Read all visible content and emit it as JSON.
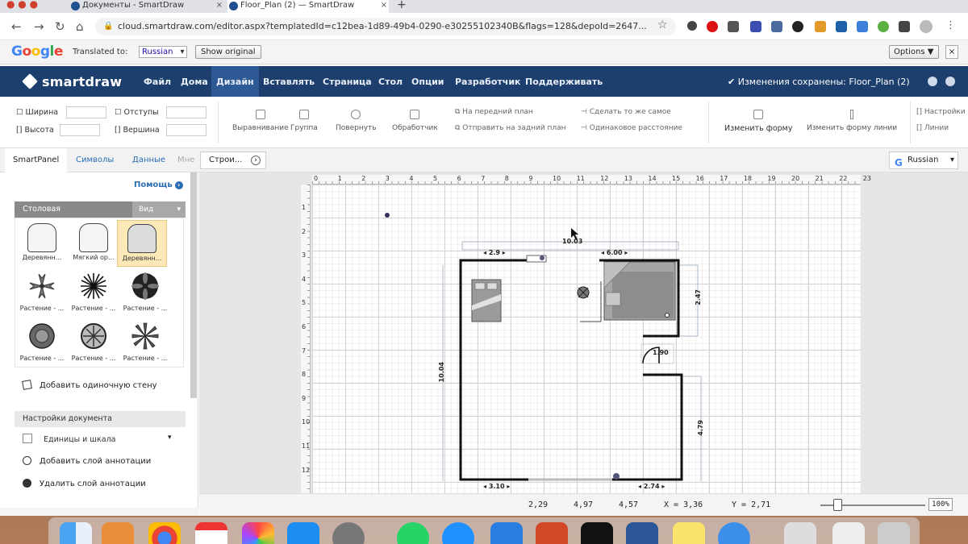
{
  "browser": {
    "tabs": [
      {
        "label": "Документы - SmartDraw",
        "active": false
      },
      {
        "label": "Floor_Plan (2) — SmartDraw",
        "active": true
      }
    ],
    "url": "cloud.smartdraw.com/editor.aspx?templatedId=c12bea-1d89-49b4-0290-e30255102340B&flags=128&depoId=2647...",
    "nav": {
      "back": "←",
      "forward": "→",
      "reload": "↻",
      "home": "⌂",
      "new_tab": "+",
      "close": "×",
      "bookmark": "☆"
    }
  },
  "translate_bar": {
    "logo": "Google",
    "label": "Translated to:",
    "language": "Russian",
    "show_original": "Show original",
    "options": "Options ▼",
    "close": "×"
  },
  "app": {
    "logo": "smartdraw",
    "menu": [
      "Файл",
      "Дома",
      "Дизайн",
      "Вставлять",
      "Страница",
      "Стол",
      "Опции",
      "Разработчик",
      "Поддерживать"
    ],
    "active_menu": "Дизайн",
    "saved_status": "Изменения сохранены: Floor_Plan (2)"
  },
  "ribbon": {
    "fields": [
      {
        "label": "Ширина",
        "value": ""
      },
      {
        "label": "Высота",
        "value": ""
      },
      {
        "label": "Отступы",
        "value": ""
      },
      {
        "label": "Вершина",
        "value": ""
      }
    ],
    "tools": [
      "Выравнивание",
      "Группа",
      "Повернуть",
      "Обработчик"
    ],
    "lines": [
      "На передний план",
      "Отправить на задний план",
      "Сделать то же самое",
      "Одинаковое расстояние"
    ],
    "change_shape": "Изменить форму",
    "extra": "Изменить форму линии",
    "right": [
      "Настройки",
      "Линии"
    ]
  },
  "panel_tabs": [
    "SmartPanel",
    "Символы",
    "Данные",
    "Мне"
  ],
  "doc_button": "Строи...",
  "lang_select": "Russian",
  "left_panel": {
    "help": "Помощь",
    "library": "Столовая",
    "view": "Вид",
    "symbols": [
      "Деревянн...",
      "Мягкий ор...",
      "Деревянн...",
      "Растение - ...",
      "Растение - ...",
      "Растение - ...",
      "Растение - ...",
      "Растение - ...",
      "Растение - ..."
    ],
    "add_wall": "Добавить одиночную стену",
    "settings_header": "Настройки документа",
    "scale_check": "Единицы и шкала",
    "add_layer": "Добавить слой аннотации",
    "remove_layer": "Удалить слой аннотации"
  },
  "canvas": {
    "ruler_top": [
      "0",
      "1",
      "2",
      "3",
      "4",
      "5",
      "6",
      "7",
      "8",
      "9",
      "10",
      "11",
      "12",
      "13",
      "14",
      "15",
      "16",
      "17",
      "18",
      "19",
      "20",
      "21",
      "22",
      "23"
    ],
    "ruler_left": [
      "1",
      "2",
      "3",
      "4",
      "5",
      "6",
      "7",
      "8",
      "9",
      "10",
      "11",
      "12"
    ],
    "dimensions": {
      "top_total": "10.03",
      "top_left": "2.9",
      "top_right": "6.00",
      "right_upper": "2.47",
      "left": "10.04",
      "right_lower": "4.79",
      "bottom_left": "3.10",
      "bottom_right": "2.74",
      "closet": "1.90"
    }
  },
  "status_bar": {
    "v1": "2,29",
    "v2": "4,97",
    "v3": "4,57",
    "x": "X = 3,36",
    "y": "Y = 2,71",
    "zoom_label": "100%"
  },
  "colors": {
    "header": "#1d3f6e",
    "active_menu": "#2d5a94",
    "link": "#2a6db5",
    "wall": "#111111"
  }
}
